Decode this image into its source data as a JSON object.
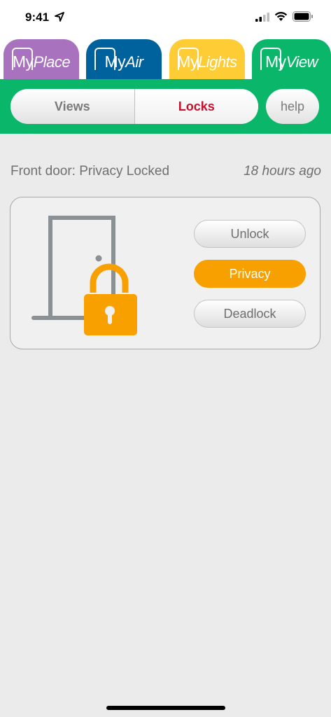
{
  "status_bar": {
    "time": "9:41"
  },
  "app_tabs": [
    {
      "prefix": "My",
      "name": "Place",
      "color": "#a872be"
    },
    {
      "prefix": "My",
      "name": "Air",
      "color": "#00629c"
    },
    {
      "prefix": "My",
      "name": "Lights",
      "color": "#fecc34"
    },
    {
      "prefix": "My",
      "name": "View",
      "color": "#0ab76a"
    }
  ],
  "toolbar": {
    "segments": [
      "Views",
      "Locks"
    ],
    "selected": "Locks",
    "help_label": "help"
  },
  "lock": {
    "status_text": "Front door: Privacy Locked",
    "time_text": "18 hours ago",
    "buttons": {
      "unlock": "Unlock",
      "privacy": "Privacy",
      "deadlock": "Deadlock"
    },
    "active_mode": "Privacy",
    "accent_color": "#f8a000"
  },
  "icons": {
    "door": "door-icon",
    "padlock": "padlock-icon"
  }
}
